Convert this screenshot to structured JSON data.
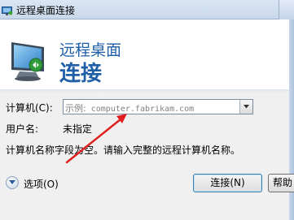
{
  "window": {
    "title": "远程桌面连接"
  },
  "header": {
    "line1": "远程桌面",
    "line2": "连接"
  },
  "form": {
    "computer_label": "计算机(C):",
    "computer_placeholder_prefix": "示例:",
    "computer_placeholder_example": "computer.fabrikam.com",
    "username_label": "用户名:",
    "username_value": "未指定",
    "info_message": "计算机名称字段为空。请输入完整的远程计算机名称。"
  },
  "footer": {
    "options_label": "选项(O)",
    "connect_label": "连接(N)",
    "help_label": "帮助"
  },
  "colors": {
    "header_text": "#1f5fa8",
    "annotation_arrow": "#e02020"
  }
}
